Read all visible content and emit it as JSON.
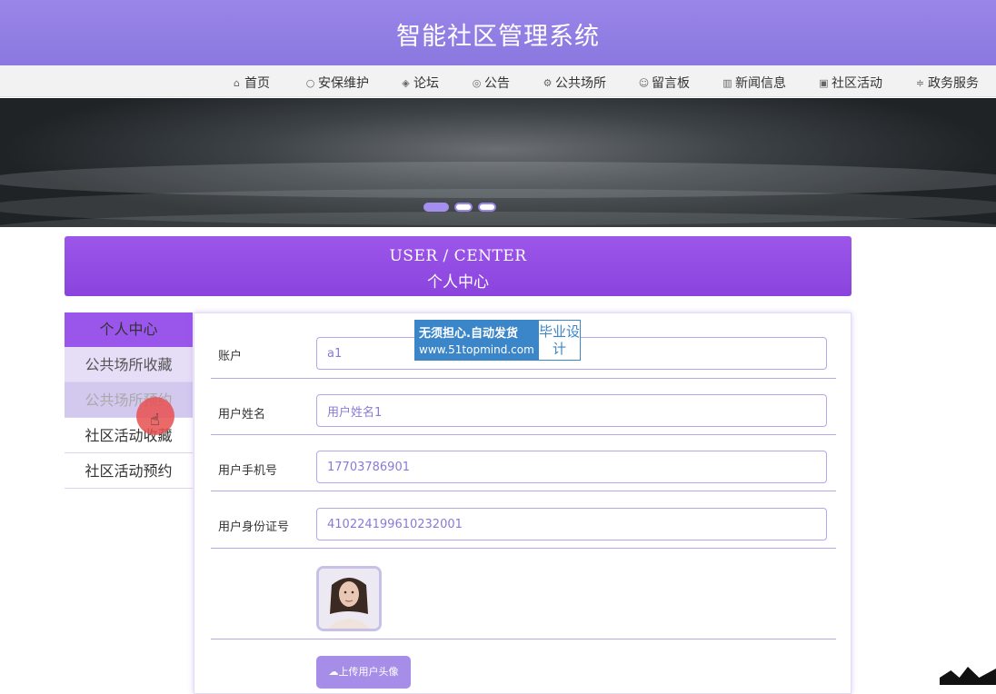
{
  "header": {
    "title": "智能社区管理系统"
  },
  "nav": {
    "items": [
      {
        "label": "首页",
        "icon": "home-icon"
      },
      {
        "label": "安保维护",
        "icon": "circle-icon"
      },
      {
        "label": "论坛",
        "icon": "cube-icon"
      },
      {
        "label": "公告",
        "icon": "palette-icon"
      },
      {
        "label": "公共场所",
        "icon": "gear-icon"
      },
      {
        "label": "留言板",
        "icon": "smile-icon"
      },
      {
        "label": "新闻信息",
        "icon": "news-icon"
      },
      {
        "label": "社区活动",
        "icon": "calendar-icon"
      },
      {
        "label": "政务服务",
        "icon": "sliders-icon"
      }
    ]
  },
  "banner": {
    "slides": 3,
    "active_slide": 1
  },
  "user_center": {
    "title_en": "USER / CENTER",
    "title_cn": "个人中心"
  },
  "sidebar": {
    "header": "个人中心",
    "items": [
      "公共场所收藏",
      "公共场所预约",
      "社区活动收藏",
      "社区活动预约"
    ]
  },
  "form": {
    "fields": [
      {
        "label": "账户",
        "value": "a1"
      },
      {
        "label": "用户姓名",
        "value": "用户姓名1"
      },
      {
        "label": "用户手机号",
        "value": "17703786901"
      },
      {
        "label": "用户身份证号",
        "value": "410224199610232001"
      }
    ],
    "upload_label": "上传用户头像"
  },
  "watermark": {
    "line1": "无须担心.自动发货",
    "line2": "www.51topmind.com",
    "side": "毕业设计"
  },
  "colors": {
    "header": "#9a86e8",
    "accent": "#9a55ea",
    "input_border": "#b7a5e8",
    "button": "#a68ee8"
  }
}
